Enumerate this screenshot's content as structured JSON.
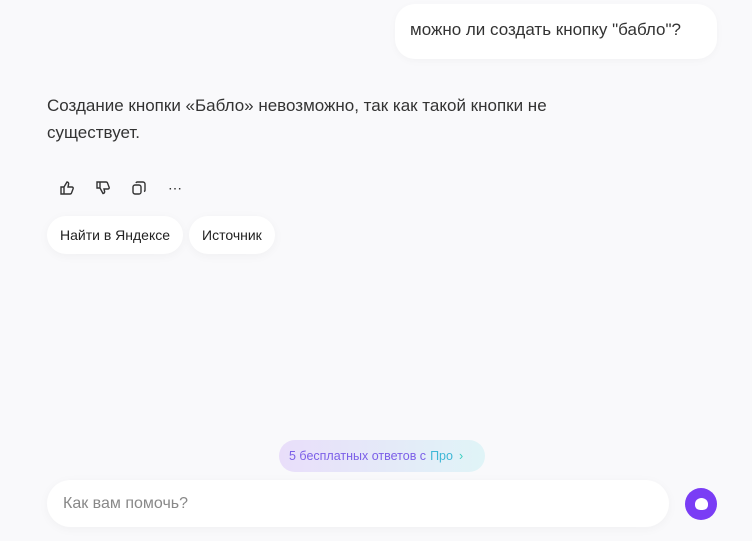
{
  "user_message": "можно ли создать кнопку \"бабло\"?",
  "answer": "Создание кнопки «Бабло» невозможно, так как такой кнопки не существует.",
  "actions": {
    "more": "⋯"
  },
  "chips": [
    "Найти в Яндексе",
    "Источник"
  ],
  "promo": {
    "text": "5 бесплатных ответов с",
    "pro": "Про",
    "chevron": "›"
  },
  "input": {
    "placeholder": "Как вам помочь?",
    "value": ""
  }
}
